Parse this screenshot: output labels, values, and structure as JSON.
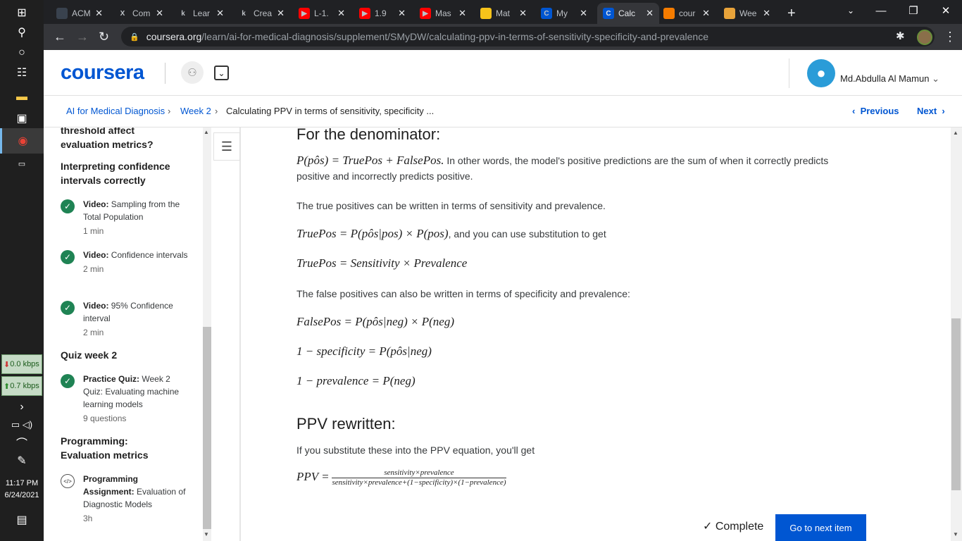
{
  "taskbar": {
    "net_down": "0.0 kbps",
    "net_up": "0.7 kbps",
    "time": "11:17 PM",
    "date": "6/24/2021"
  },
  "browser": {
    "tabs": [
      {
        "label": "ACM",
        "icon": "hackerrank-icon",
        "color": "#39424e"
      },
      {
        "label": "Com",
        "icon": "x-icon",
        "color": "#202124"
      },
      {
        "label": "Lear",
        "icon": "k-icon",
        "color": "#202124"
      },
      {
        "label": "Crea",
        "icon": "k-icon",
        "color": "#202124"
      },
      {
        "label": "L-1.",
        "icon": "youtube-icon",
        "color": "#ff0000"
      },
      {
        "label": "1.9",
        "icon": "youtube-icon",
        "color": "#ff0000"
      },
      {
        "label": "Mas",
        "icon": "youtube-icon",
        "color": "#ff0000"
      },
      {
        "label": "Mat",
        "icon": "classroom-icon",
        "color": "#f7c31a"
      },
      {
        "label": "My",
        "icon": "coursera-icon",
        "color": "#0056d2"
      },
      {
        "label": "Calc",
        "icon": "coursera-icon",
        "color": "#0056d2"
      },
      {
        "label": "cour",
        "icon": "loading-icon",
        "color": "#f57c00"
      },
      {
        "label": "Wee",
        "icon": "document-icon",
        "color": "#e8a33a"
      }
    ],
    "url_domain": "coursera.org",
    "url_path": "/learn/ai-for-medical-diagnosis/supplement/SMyDW/calculating-ppv-in-terms-of-sensitivity-specificity-and-prevalence"
  },
  "header": {
    "logo": "coursera",
    "user_name": "Md.Abdulla Al Mamun"
  },
  "breadcrumb": {
    "course": "AI for Medical Diagnosis",
    "week": "Week 2",
    "page": "Calculating PPV in terms of sensitivity, specificity ...",
    "previous": "Previous",
    "next": "Next"
  },
  "sidebar": {
    "top_cut_line1": "threshold affect",
    "top_cut_line2": "evaluation metrics?",
    "sec1_line1": "Interpreting confidence",
    "sec1_line2": "intervals correctly",
    "items1": [
      {
        "type": "Video:",
        "title": "Sampling from the Total Population",
        "dur": "1 min"
      },
      {
        "type": "Video:",
        "title": "Confidence intervals",
        "dur": "2 min"
      },
      {
        "type": "Video:",
        "title": "95% Confidence interval",
        "dur": "2 min"
      }
    ],
    "sec2": "Quiz week 2",
    "quiz": {
      "type": "Practice Quiz:",
      "title": "Week 2 Quiz: Evaluating machine learning models",
      "dur": "9 questions"
    },
    "sec3_line1": "Programming:",
    "sec3_line2": "Evaluation metrics",
    "prog": {
      "type": "Programming Assignment:",
      "title": "Evaluation of Diagnostic Models",
      "dur": "3h"
    }
  },
  "content": {
    "denominator_heading": "For the denominator:",
    "eq1": "P(pôs) = TruePos + FalsePos.",
    "eq1_text": "In other words, the model's positive predictions are the sum of when it correctly predicts positive and incorrectly predicts positive.",
    "para_tp": "The true positives can be written in terms of sensitivity and prevalence.",
    "eq2": "TruePos = P(pôs|pos) × P(pos)",
    "eq2_text": ", and you can use substitution to get",
    "eq3": "TruePos = Sensitivity × Prevalence",
    "para_fp": "The false positives can also be written in terms of specificity and prevalence:",
    "eq4": "FalsePos = P(pôs|neg) × P(neg)",
    "eq5": "1 − specificity = P(pôs|neg)",
    "eq6": "1 − prevalence = P(neg)",
    "ppv_heading": "PPV rewritten:",
    "para_sub": "If you substitute these into the PPV equation, you'll get",
    "ppv_lhs": "PPV =",
    "ppv_num": "sensitivity×prevalence",
    "ppv_den": "sensitivity×prevalence+(1−specificity)×(1−prevalence)"
  },
  "footer": {
    "complete": "✓ Complete",
    "next_item": "Go to next item"
  }
}
